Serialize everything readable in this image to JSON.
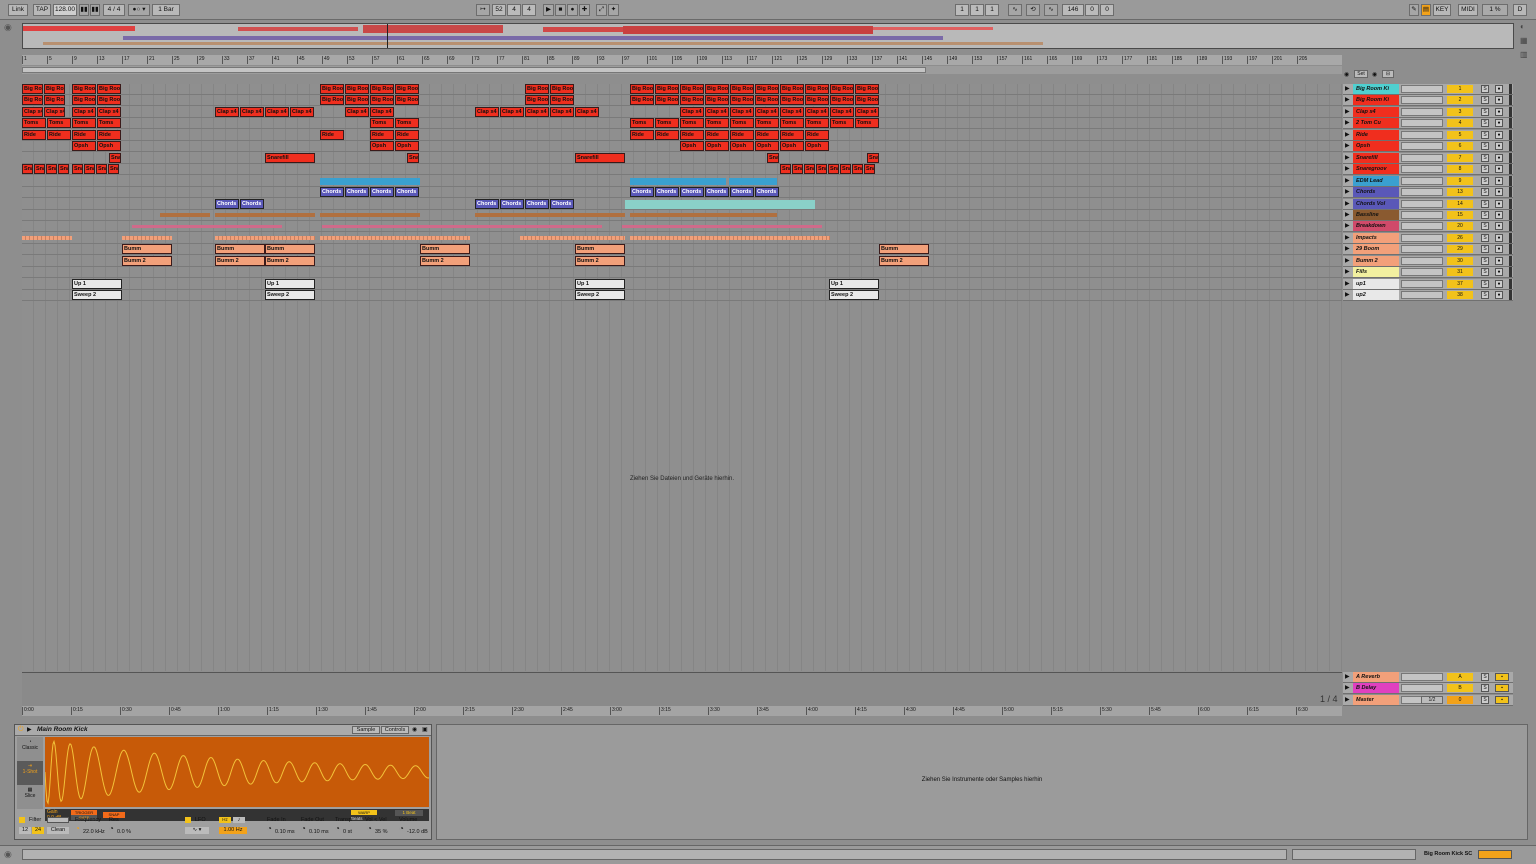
{
  "transport": {
    "link": "Link",
    "tap": "TAP",
    "tempo": "128.00",
    "metronome": "4 / 4",
    "quantize": "1 Bar",
    "position": [
      "52",
      "4",
      "4"
    ],
    "loop_start": [
      "1",
      "1",
      "1"
    ],
    "loop_length": [
      "146",
      "0",
      "0"
    ],
    "key_label": "KEY",
    "midi_label": "MIDI",
    "cpu": "1 %",
    "d_label": "D"
  },
  "ruler_marks": [
    "1",
    "5",
    "9",
    "13",
    "17",
    "21",
    "25",
    "29",
    "33",
    "37",
    "41",
    "45",
    "49",
    "53",
    "57",
    "61",
    "65",
    "69",
    "73",
    "77",
    "81",
    "85",
    "89",
    "93",
    "97",
    "101",
    "105",
    "109",
    "113",
    "117",
    "121",
    "125",
    "129",
    "133",
    "137",
    "141",
    "145",
    "149",
    "153",
    "157",
    "161",
    "165",
    "169",
    "173",
    "177",
    "181",
    "185",
    "189",
    "193",
    "197",
    "201",
    "205"
  ],
  "set_label": "Set",
  "tracks": [
    {
      "name": "Big Room Ki",
      "num": "1",
      "color": "#4fd0d0"
    },
    {
      "name": "Big Room Ki",
      "num": "2",
      "color": "#f02e1e"
    },
    {
      "name": "Clap x4",
      "num": "3",
      "color": "#f02e1e"
    },
    {
      "name": "2 Tom Cu",
      "num": "4",
      "color": "#f02e1e"
    },
    {
      "name": "Ride",
      "num": "5",
      "color": "#f02e1e"
    },
    {
      "name": "Opsh",
      "num": "6",
      "color": "#f02e1e"
    },
    {
      "name": "Snarefill",
      "num": "7",
      "color": "#f02e1e"
    },
    {
      "name": "Snaregroov",
      "num": "8",
      "color": "#f02e1e"
    },
    {
      "name": "EDM Lead",
      "num": "9",
      "color": "#3aa0d0"
    },
    {
      "name": "Chords",
      "num": "13",
      "color": "#5a58b8"
    },
    {
      "name": "Chords Vol",
      "num": "14",
      "color": "#5a58b8"
    },
    {
      "name": "Bassline",
      "num": "15",
      "color": "#8a5a30"
    },
    {
      "name": "Breakdown",
      "num": "20",
      "color": "#d04a6a"
    },
    {
      "name": "Impacts",
      "num": "26",
      "color": "#f2a07a"
    },
    {
      "name": "29 Boom",
      "num": "29",
      "color": "#f2a07a"
    },
    {
      "name": "Bumm 2",
      "num": "30",
      "color": "#f2a07a"
    },
    {
      "name": "Fills",
      "num": "31",
      "color": "#f2f0a0"
    },
    {
      "name": "up1",
      "num": "37",
      "color": "#e8e8e8"
    },
    {
      "name": "up2",
      "num": "38",
      "color": "#e8e8e8"
    }
  ],
  "return_tracks": [
    {
      "name": "A Reverb",
      "num": "A",
      "color": "#f2a07a"
    },
    {
      "name": "B Delay",
      "num": "B",
      "color": "#e040c0"
    },
    {
      "name": "Master",
      "num": "0",
      "color": "#f2a07a"
    }
  ],
  "clip_labels": {
    "kick": "Big Roo",
    "clap": "Clap x4",
    "toms": "Toms",
    "ride": "Ride",
    "opsh": "Opsh",
    "snarefill": "Snarefill",
    "sna": "Sna",
    "chords": "Chords",
    "bumm": "Bumm",
    "bumm2": "Bumm 2",
    "up1": "Up 1",
    "sweep2": "Sweep 2"
  },
  "drop_hint": "Ziehen Sie Dateien und Geräte hierhin.",
  "time_marks": [
    "0:00",
    "0:15",
    "0:30",
    "0:45",
    "1:00",
    "1:15",
    "1:30",
    "1:45",
    "2:00",
    "2:15",
    "2:30",
    "2:45",
    "3:00",
    "3:15",
    "3:30",
    "3:45",
    "4:00",
    "4:15",
    "4:30",
    "4:45",
    "5:00",
    "5:15",
    "5:30",
    "5:45",
    "6:00",
    "6:15",
    "6:30"
  ],
  "zoom_label": "1 / 4",
  "master_route": "1/2",
  "device": {
    "title": "Main Room Kick",
    "tab_sample": "Sample",
    "tab_controls": "Controls",
    "modes": [
      "Classic",
      "1-Shot",
      "Slice"
    ],
    "gain_label": "Gain",
    "gain_value": "0.0 dB",
    "trigger": "TRIGGER",
    "gate": "GATE",
    "snap": "SNAP",
    "warp": "WARP",
    "beat": "1 Beat",
    "beats": "Beats",
    "filter_label": "Filter",
    "frequency_label": "Frequency",
    "frequency_value": "22.0 kHz",
    "res_label": "Res",
    "res_value": "0.0 %",
    "lfo_label": "LFO",
    "lfo_rate": "1.00 Hz",
    "hz": "Hz",
    "fade_in_label": "Fade In",
    "fade_in_value": "0.10 ms",
    "fade_out_label": "Fade Out",
    "fade_out_value": "0.10 ms",
    "transp_label": "Transp",
    "transp_value": "0 st",
    "volvel_label": "Vol < Vel",
    "volvel_value": "35 %",
    "volume_label": "Volume",
    "volume_value": "-12.0 dB",
    "filter_type": "Clean",
    "filter_12": "12",
    "filter_24": "24"
  },
  "drop_instruments": "Ziehen Sie Instrumente oder Samples hierhin",
  "status": {
    "track_name": "Big Room Kick SC"
  }
}
